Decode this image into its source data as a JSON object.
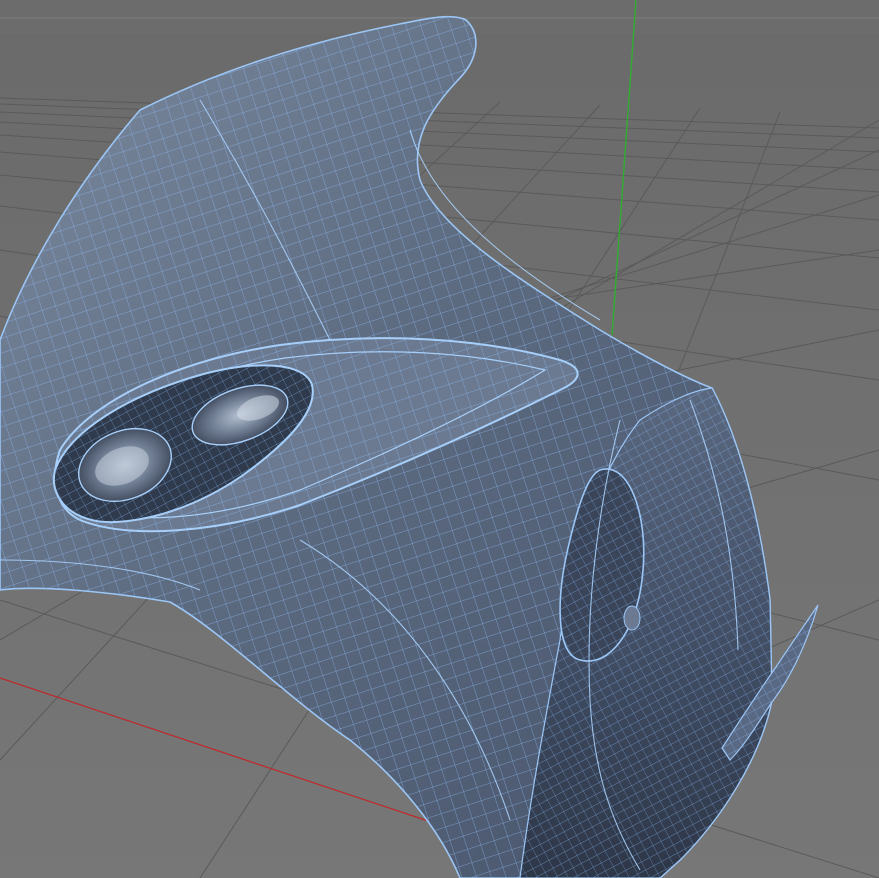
{
  "viewport": {
    "view": "perspective",
    "background_color": "#707070",
    "show_grid": true,
    "grid_color": "#5a5a5a",
    "axis_colors": {
      "x": "#c02828",
      "y": "#2fae2f"
    },
    "mesh_fill_color": "#5f6f86",
    "wire_color": "#7fb0ee",
    "object": "subdivision-surface-mesh"
  }
}
